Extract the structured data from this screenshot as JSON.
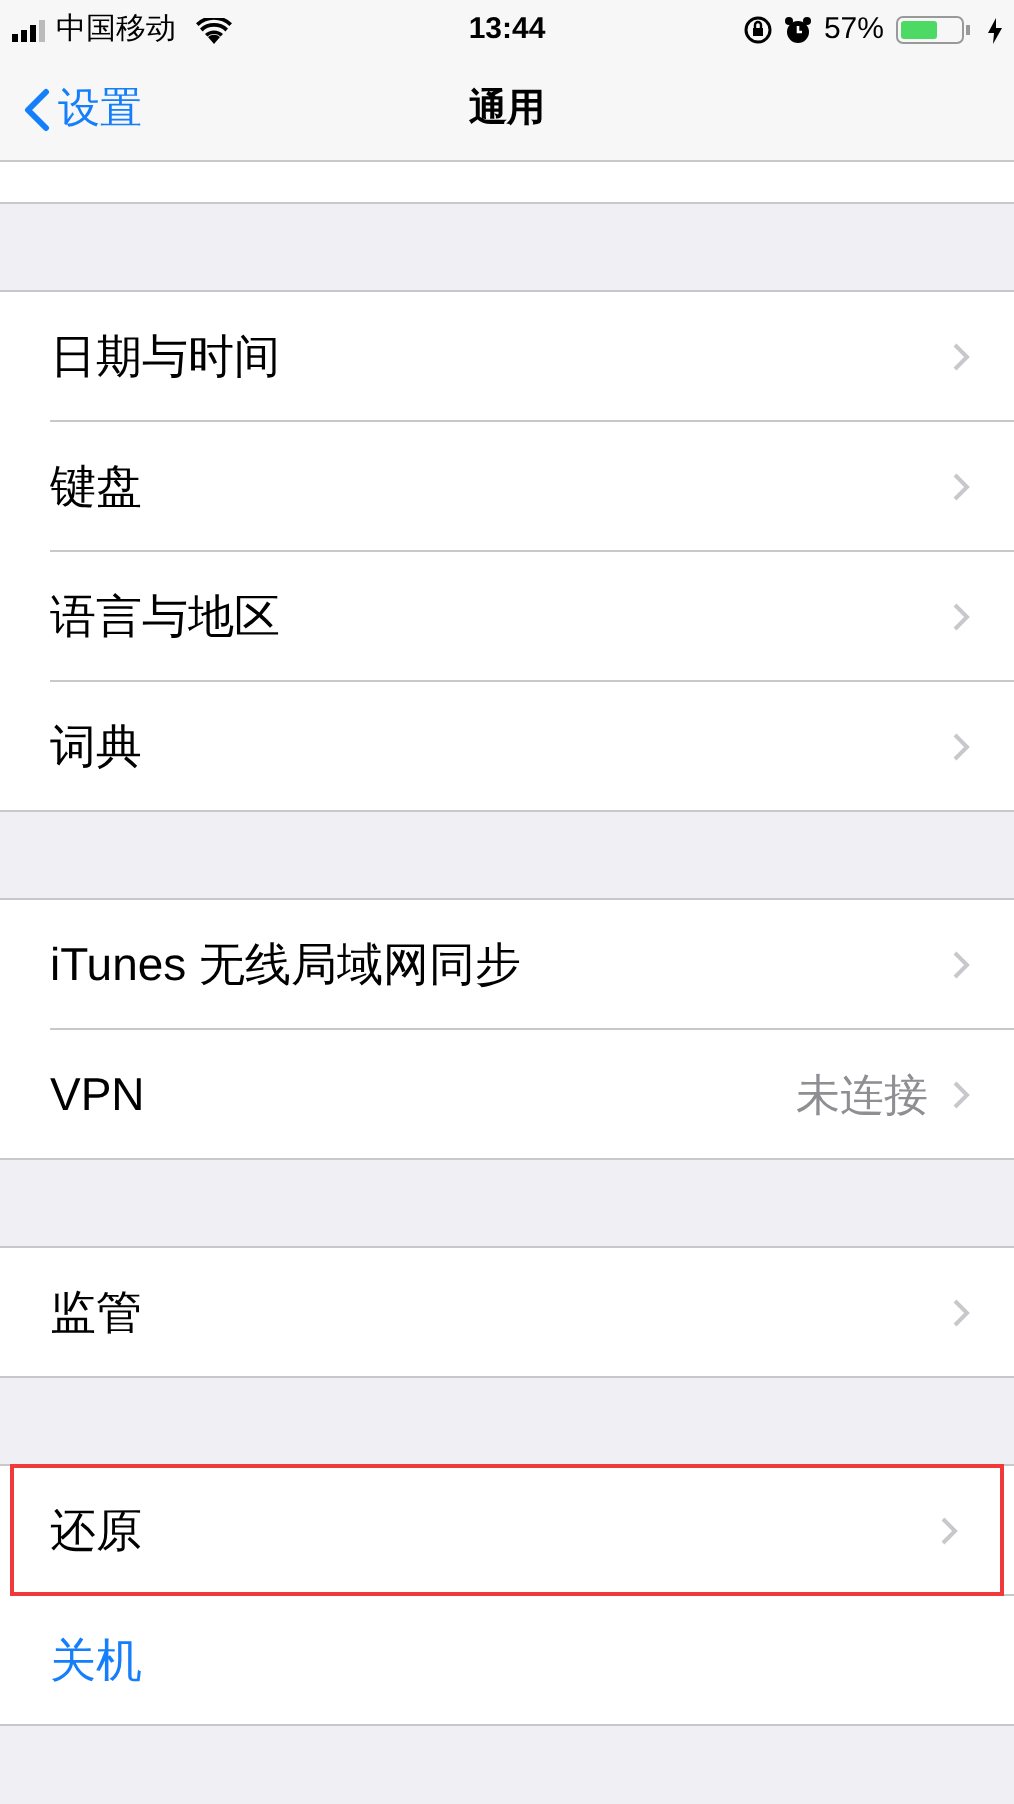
{
  "status_bar": {
    "carrier": "中国移动",
    "time": "13:44",
    "battery": "57%"
  },
  "nav": {
    "back": "设置",
    "title": "通用"
  },
  "groups": [
    {
      "items": [
        {
          "label": "日期与时间",
          "kind": "link",
          "highlighted": false
        },
        {
          "label": "键盘",
          "kind": "link",
          "highlighted": false
        },
        {
          "label": "语言与地区",
          "kind": "link",
          "highlighted": false
        },
        {
          "label": "词典",
          "kind": "link",
          "highlighted": false
        }
      ]
    },
    {
      "items": [
        {
          "label": "iTunes 无线局域网同步",
          "kind": "link",
          "highlighted": false
        },
        {
          "label": "VPN",
          "value": "未连接",
          "kind": "link",
          "highlighted": false
        }
      ]
    },
    {
      "items": [
        {
          "label": "监管",
          "kind": "link",
          "highlighted": false
        }
      ]
    },
    {
      "items": [
        {
          "label": "还原",
          "kind": "link",
          "highlighted": true
        },
        {
          "label": "关机",
          "kind": "action",
          "highlighted": false
        }
      ]
    }
  ]
}
